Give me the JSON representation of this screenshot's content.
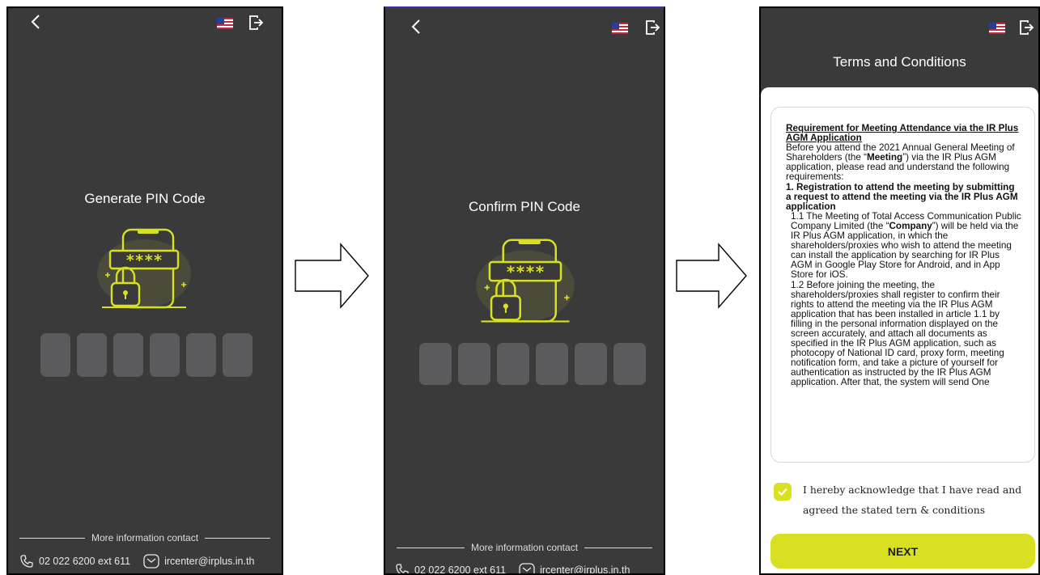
{
  "screen1": {
    "title": "Generate PIN Code",
    "pin_slots": 6,
    "footer_label": "More information contact",
    "phone": "02 022 6200 ext 611",
    "email": "ircenter@irplus.in.th"
  },
  "screen2": {
    "title": "Confirm PIN Code",
    "pin_slots": 6,
    "footer_label": "More information contact",
    "phone": "02 022 6200 ext 611",
    "email": "ircenter@irplus.in.th"
  },
  "screen3": {
    "title": "Terms and Conditions",
    "terms": {
      "heading": "Requirement for Meeting Attendance via the IR Plus AGM Application",
      "intro_pre": "Before you attend the 2021 Annual General Meeting of Shareholders (the “",
      "intro_bold": "Meeting",
      "intro_post": "”) via the IR Plus AGM application, please read and understand the following requirements:",
      "section1": "1. Registration to attend the meeting by submitting a request to attend the meeting via the IR Plus AGM application",
      "p11_pre": "1.1 The Meeting of Total Access Communication Public Company Limited (the “",
      "p11_bold": "Company",
      "p11_post": "”) will be held via the IR Plus AGM application, in which the shareholders/proxies who wish to attend the meeting can install the application by searching for IR Plus AGM in Google Play Store for Android, and in App Store for iOS.",
      "p12": "1.2 Before joining the meeting, the shareholders/proxies shall register to confirm their rights to attend the meeting via the IR Plus AGM application that has been installed in article 1.1 by filling in the personal information displayed on the screen accurately, and attach all documents as specified in the IR Plus AGM application, such as photocopy of National ID card, proxy form, meeting notification form, and take a picture of yourself for authentication as instructed by the IR Plus AGM application. After that, the system will send One"
    },
    "acknowledge_line1": "I hereby acknowledge that I have read and",
    "acknowledge_line2": "agreed the stated tern & conditions",
    "acknowledged": true,
    "next_label": "NEXT"
  },
  "colors": {
    "background": "#3a3a3a",
    "pin_box": "#5b5b5d",
    "accent": "#d9e021"
  },
  "icons": [
    "back-arrow-icon",
    "us-flag-icon",
    "logout-icon",
    "lock-icon",
    "phone-icon",
    "email-icon",
    "checkmark-icon",
    "right-arrow-icon"
  ]
}
